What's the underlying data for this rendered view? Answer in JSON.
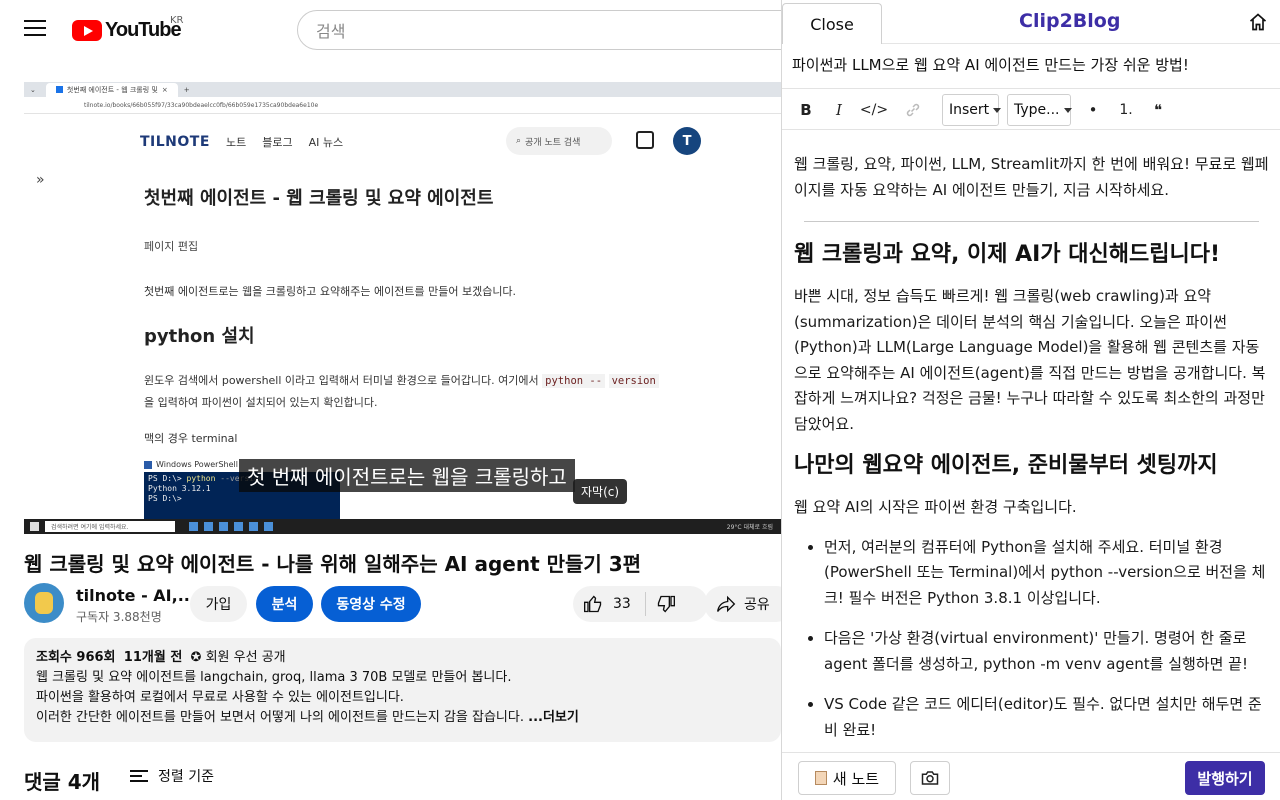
{
  "youtube": {
    "logo_text": "YouTube",
    "region": "KR",
    "search_placeholder": "검색",
    "browser_tab": "첫번째 에이전트 - 웹 크롤링 및",
    "browser_url": "tilnote.io/books/66b055f97/33ca90bdeaelcc0fb/66b059e1735ca90bdea6e10e",
    "tilnote": {
      "logo": "TILNOTE",
      "nav": [
        "노트",
        "블로그",
        "AI 뉴스"
      ],
      "search": "공개 노트 검색",
      "avatar": "T",
      "h1": "첫번째 에이전트 - 웹 크롤링 및 요약 에이전트",
      "sub": "페이지 편집",
      "p1": "첫번째 에이전트로는 웹을 크롤링하고 요약해주는 에이전트를 만들어 보겠습니다.",
      "h2": "python 설치",
      "p2a": "윈도우 검색에서 powershell 이라고 입력해서 터미널 환경으로 들어갑니다. 여기에서",
      "p2code1": "python --",
      "p2code2": "version",
      "p2b": "을 입력하여 파이썬이 설치되어 있는지 확인합니다.",
      "p3": "맥의 경우 terminal",
      "ps_title": "Windows PowerShell",
      "ps_line1a": "PS D:\\> ",
      "ps_line1b": "python",
      "ps_line1c": " --version",
      "ps_line2": "Python 3.12.1",
      "ps_line3": "PS D:\\>"
    },
    "caption": "첫 번째 에이전트로는 웹을 크롤링하고",
    "cc_tooltip": "자막(c)",
    "taskbar_search": "검색하려면 여기에 입력하세요.",
    "taskbar_weather": "29°C 대체로 흐림",
    "video_title": "웹 크롤링 및 요약 에이전트 - 나를 위해 일해주는 AI agent 만들기 3편",
    "channel_name": "tilnote - AI,...",
    "subscribers": "구독자 3.88천명",
    "join": "가입",
    "analyze": "분석",
    "edit_video": "동영상 수정",
    "likes": "33",
    "share": "공유",
    "desc_views": "조회수 966회",
    "desc_date": "11개월 전",
    "desc_members": "회원 우선 공개",
    "desc_line1": "웹 크롤링 및 요약 에이전트를 langchain, groq, llama 3 70B 모델로 만들어 봅니다.",
    "desc_line2": "파이썬을 활용하여 로컬에서 무료로 사용할 수 있는 에이전트입니다.",
    "desc_line3": "이러한 간단한 에이전트를 만들어 보면서 어떻게 나의 에이전트를 만드는지 감을 잡습니다.",
    "desc_more": "...더보기",
    "comments": "댓글 4개",
    "sort": "정렬 기준"
  },
  "clip2blog": {
    "close": "Close",
    "brand": "Clip2Blog",
    "title": "파이썬과 LLM으로 웹 요약 AI 에이전트 만드는 가장 쉬운 방법!",
    "toolbar": {
      "bold": "B",
      "italic": "I",
      "code": "</>",
      "insert": "Insert",
      "type": "Type...",
      "bullet": "•",
      "ordered": "1.",
      "quote": "❝"
    },
    "intro": "웹 크롤링, 요약, 파이썬, LLM, Streamlit까지 한 번에 배워요! 무료로 웹페이지를 자동 요약하는 AI 에이전트 만들기, 지금 시작하세요.",
    "h1": "웹 크롤링과 요약, 이제 AI가 대신해드립니다!",
    "p1": "바쁜 시대, 정보 습득도 빠르게! 웹 크롤링(web crawling)과 요약(summarization)은 데이터 분석의 핵심 기술입니다. 오늘은 파이썬(Python)과 LLM(Large Language Model)을 활용해 웹 콘텐츠를 자동으로 요약해주는 AI 에이전트(agent)를 직접 만드는 방법을 공개합니다. 복잡하게 느껴지나요? 걱정은 금물! 누구나 따라할 수 있도록 최소한의 과정만 담았어요.",
    "h2": "나만의 웹요약 에이전트, 준비물부터 셋팅까지",
    "p2": "웹 요약 AI의 시작은 파이썬 환경 구축입니다.",
    "items": [
      "먼저, 여러분의 컴퓨터에 Python을 설치해 주세요. 터미널 환경(PowerShell 또는 Terminal)에서 python --version으로 버전을 체크! 필수 버전은 Python 3.8.1 이상입니다.",
      "다음은 '가상 환경(virtual environment)' 만들기. 명령어 한 줄로 agent 폴더를 생성하고, python -m venv agent를 실행하면 끝!",
      "VS Code 같은 코드 에디터(editor)도 필수. 없다면 설치만 해두면 준비 완료!"
    ],
    "new_note": "새 노트",
    "publish": "발행하기"
  },
  "colors": {
    "youtube_red": "#ff0000",
    "youtube_blue": "#065fd4",
    "clip2blog_purple": "#3d2ea6",
    "tilnote_navy": "#16457e"
  }
}
